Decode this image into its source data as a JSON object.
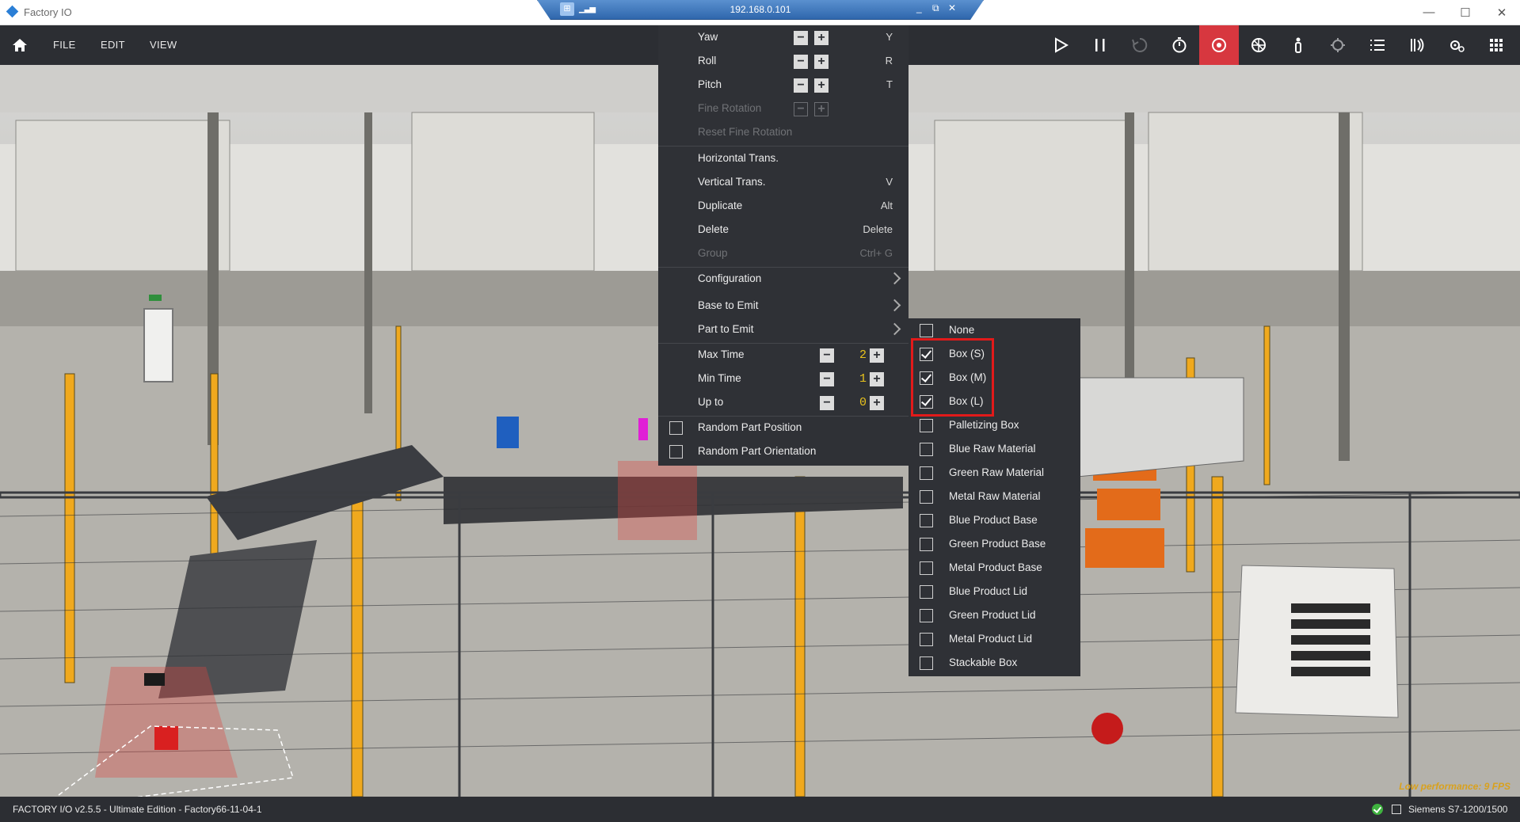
{
  "window": {
    "title": "Factory IO",
    "controls": {
      "minimize": "—",
      "maximize": "☐",
      "close": "✕"
    }
  },
  "remote": {
    "ip": "192.168.0.101",
    "controls": {
      "minimize": "_",
      "restore": "⧉",
      "close": "✕"
    }
  },
  "toolbar": {
    "menus": [
      "FILE",
      "EDIT",
      "VIEW"
    ],
    "icons": [
      "home-icon",
      "play-icon",
      "pause-icon",
      "reset-icon",
      "timer-icon",
      "camera-icon",
      "fly-camera-icon",
      "first-person-icon",
      "sensor-icon",
      "list-icon",
      "signal-icon",
      "settings-icon",
      "grid-icon"
    ],
    "active_color": "#d7373f"
  },
  "context_menu": {
    "rotation": [
      {
        "label": "Yaw",
        "shortcut": "Y",
        "enabled": true
      },
      {
        "label": "Roll",
        "shortcut": "R",
        "enabled": true
      },
      {
        "label": "Pitch",
        "shortcut": "T",
        "enabled": true
      },
      {
        "label": "Fine Rotation",
        "shortcut": "",
        "enabled": false
      },
      {
        "label": "Reset Fine Rotation",
        "shortcut": "",
        "enabled": false
      }
    ],
    "edit": [
      {
        "label": "Horizontal Trans.",
        "shortcut": "",
        "enabled": true
      },
      {
        "label": "Vertical Trans.",
        "shortcut": "V",
        "enabled": true
      },
      {
        "label": "Duplicate",
        "shortcut": "Alt",
        "enabled": true
      },
      {
        "label": "Delete",
        "shortcut": "Delete",
        "enabled": true
      },
      {
        "label": "Group",
        "shortcut": "Ctrl+ G",
        "enabled": false
      }
    ],
    "config": [
      {
        "label": "Configuration"
      },
      {
        "label": "Base to Emit"
      },
      {
        "label": "Part to Emit"
      }
    ],
    "numbers": [
      {
        "label": "Max Time",
        "value": "2"
      },
      {
        "label": "Min Time",
        "value": "1"
      },
      {
        "label": "Up to",
        "value": "0"
      }
    ],
    "options": [
      {
        "label": "Random Part Position",
        "checked": false
      },
      {
        "label": "Random Part Orientation",
        "checked": false
      }
    ]
  },
  "part_menu": {
    "items": [
      {
        "label": "None",
        "checked": false
      },
      {
        "label": "Box (S)",
        "checked": true
      },
      {
        "label": "Box (M)",
        "checked": true
      },
      {
        "label": "Box (L)",
        "checked": true
      },
      {
        "label": "Palletizing Box",
        "checked": false
      },
      {
        "label": "Blue Raw Material",
        "checked": false
      },
      {
        "label": "Green Raw Material",
        "checked": false
      },
      {
        "label": "Metal Raw Material",
        "checked": false
      },
      {
        "label": "Blue Product Base",
        "checked": false
      },
      {
        "label": "Green Product Base",
        "checked": false
      },
      {
        "label": "Metal Product Base",
        "checked": false
      },
      {
        "label": "Blue Product Lid",
        "checked": false
      },
      {
        "label": "Green Product Lid",
        "checked": false
      },
      {
        "label": "Metal Product Lid",
        "checked": false
      },
      {
        "label": "Stackable Box",
        "checked": false
      }
    ],
    "highlight_color": "#e21a1a"
  },
  "viewport": {
    "performance_warning": "Low performance: 9 FPS"
  },
  "status": {
    "app_info": "FACTORY I/O v2.5.5 - Ultimate Edition - Factory66-11-04-1",
    "plc": "Siemens S7-1200/1500"
  }
}
